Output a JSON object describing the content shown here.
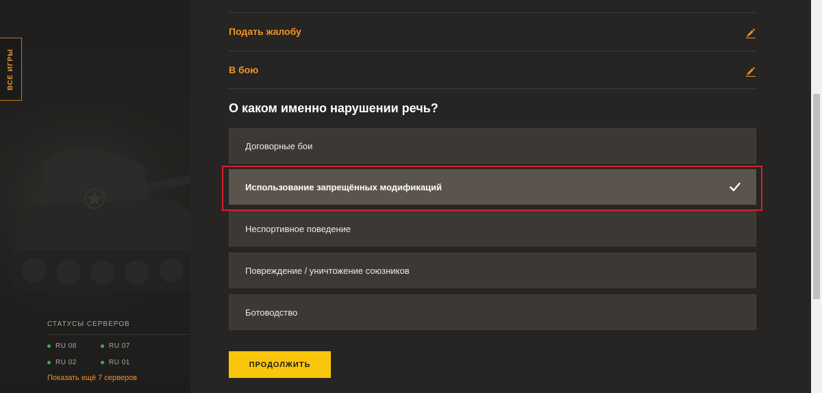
{
  "sidebar": {
    "all_games_label": "ВСЕ ИГРЫ",
    "status_title": "СТАТУСЫ СЕРВЕРОВ",
    "servers": [
      {
        "name": "RU 08",
        "status_color": "#3fb33f"
      },
      {
        "name": "RU 07",
        "status_color": "#3fb33f"
      },
      {
        "name": "RU 02",
        "status_color": "#3fb33f"
      },
      {
        "name": "RU 01",
        "status_color": "#3fb33f"
      }
    ],
    "more_servers": "Показать ещё 7 серверов"
  },
  "steps": [
    {
      "label": "Подать жалобу",
      "icon": "pencil-icon"
    },
    {
      "label": "В бою",
      "icon": "pencil-icon"
    }
  ],
  "question": "О каком именно нарушении речь?",
  "options": [
    {
      "label": "Договорные бои",
      "selected": false
    },
    {
      "label": "Использование запрещённых модификаций",
      "selected": true
    },
    {
      "label": "Неспортивное поведение",
      "selected": false
    },
    {
      "label": "Повреждение / уничтожение союзников",
      "selected": false
    },
    {
      "label": "Ботоводство",
      "selected": false
    }
  ],
  "continue_label": "ПРОДОЛЖИТЬ",
  "colors": {
    "accent": "#f39324",
    "button": "#f9c60b",
    "highlight": "#d6232a",
    "status_online": "#3fb33f"
  }
}
